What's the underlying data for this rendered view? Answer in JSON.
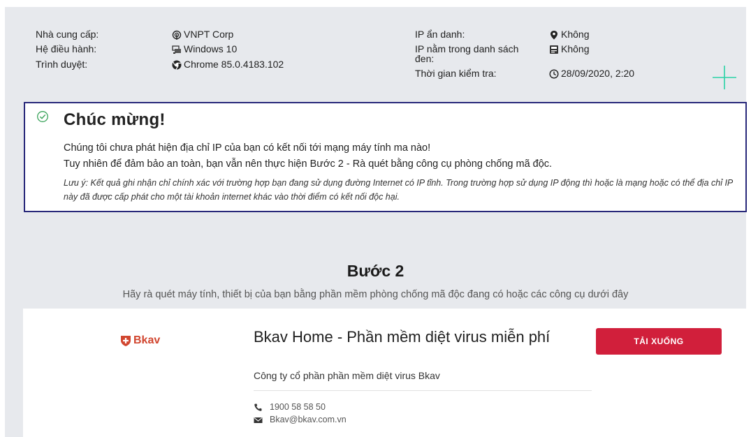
{
  "info": {
    "provider_label": "Nhà cung cấp:",
    "provider_value": "VNPT Corp",
    "os_label": "Hệ điều hành:",
    "os_value": "Windows 10",
    "browser_label": "Trình duyệt:",
    "browser_value": "Chrome 85.0.4183.102",
    "anon_label": "IP ẩn danh:",
    "anon_value": "Không",
    "blacklist_label": "IP nằm trong danh sách đen:",
    "blacklist_value": "Không",
    "time_label": "Thời gian kiểm tra:",
    "time_value": "28/09/2020, 2:20"
  },
  "result": {
    "title": "Chúc mừng!",
    "line1": "Chúng tôi chưa phát hiện địa chỉ IP của bạn có kết nối tới mạng máy tính ma nào!",
    "line2": "Tuy nhiên để đảm bảo an toàn, bạn vẫn nên thực hiện Bước 2 - Rà quét bằng công cụ phòng chống mã độc.",
    "note": "Lưu ý: Kết quả ghi nhận chỉ chính xác với trường hợp bạn đang sử dụng đường Internet có IP tĩnh. Trong trường hợp sử dụng IP động thì hoặc là mạng hoặc có thể địa chỉ IP này đã được cấp phát cho một tài khoản internet khác vào thời điểm có kết nối độc hại."
  },
  "step2": {
    "title": "Bước 2",
    "subtitle": "Hãy rà quét máy tính, thiết bị của bạn bằng phần mềm phòng chống mã độc đang có hoặc các công cụ dưới đây"
  },
  "product": {
    "logo_text": "Bkav",
    "name": "Bkav Home - Phần mềm diệt virus miễn phí",
    "company": "Công ty cổ phần phần mềm diệt virus Bkav",
    "phone": "1900 58 58 50",
    "email": "Bkav@bkav.com.vn",
    "download_label": "TẢI XUỐNG"
  },
  "colors": {
    "page_bg": "#e7e9ed",
    "result_border": "#28287a",
    "success_icon": "#3aa35a",
    "download_button": "#d11f3b",
    "accent_plus": "#2bd3a6",
    "brand_logo": "#d1462f"
  },
  "icons": {
    "provider": "wifi-pin-icon",
    "os": "windows-network-icon",
    "browser": "chrome-icon",
    "anon": "map-marker-icon",
    "blacklist": "id-card-icon",
    "time": "clock-icon",
    "success": "check-circle-icon",
    "phone": "phone-icon",
    "email": "envelope-icon",
    "logo": "shield-plus-icon"
  }
}
